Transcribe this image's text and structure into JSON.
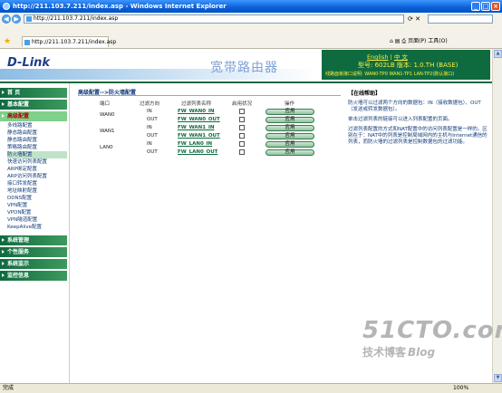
{
  "window": {
    "title": "http://211.103.7.211/index.asp - Windows Internet Explorer"
  },
  "browser": {
    "address": "http://211.103.7.211/index.asp",
    "tab_title": "http://211.103.7.211/index.asp",
    "cmd_page": "页面(P)",
    "cmd_tools": "工具(O)",
    "status": "完成",
    "zoom": "100%"
  },
  "header": {
    "brand": "D-Link",
    "product": "宽带路由器",
    "lang_en": "English",
    "lang_sep": "|",
    "lang_cn": "中 文",
    "model": "型号: 602LB 版本: 1.0.TH (BASE)",
    "line_info": "线路面板接口说明: WAN0-TP0 WAN1-TP1 LAN-TP2(默认接口)"
  },
  "sidebar": {
    "sections": [
      {
        "label": "首 页"
      },
      {
        "label": "基本配置"
      },
      {
        "label": "高级配置"
      }
    ],
    "sub_items": [
      "多线路配置",
      "静态路由配置",
      "静态路由配置",
      "策略路由配置",
      "防火墙配置",
      "快速访问列表配置",
      "ARP绑定配置",
      "ARP访问列表配置",
      "接口转发配置",
      "地址映射配置",
      "DDNS配置",
      "VPN配置",
      "VPDN配置",
      "VPN隧道配置",
      "KeepAlive配置"
    ],
    "sections_bottom": [
      {
        "label": "系统管理"
      },
      {
        "label": "个性服务"
      },
      {
        "label": "系统监示"
      },
      {
        "label": "监控信息"
      }
    ]
  },
  "main": {
    "breadcrumb": "高级配置-->防火墙配置",
    "columns": [
      "端口",
      "过滤方向",
      "过滤列表名称",
      "启用状况",
      "操作"
    ],
    "rows": [
      {
        "port": "WAN0",
        "dir": "IN",
        "list": "FW_WAN0_IN",
        "action": "应用"
      },
      {
        "port": "",
        "dir": "OUT",
        "list": "FW_WAN0_OUT",
        "action": "应用"
      },
      {
        "port": "WAN1",
        "dir": "IN",
        "list": "FW_WAN1_IN",
        "action": "应用"
      },
      {
        "port": "",
        "dir": "OUT",
        "list": "FW_WAN1_OUT",
        "action": "应用"
      },
      {
        "port": "LAN0",
        "dir": "IN",
        "list": "FW_LAN0_IN",
        "action": "应用"
      },
      {
        "port": "",
        "dir": "OUT",
        "list": "FW_LAN0_OUT",
        "action": "应用"
      }
    ]
  },
  "help": {
    "title": "【在线帮助】",
    "p1": "防火墙可以过滤两个方向的数据包：IN（接收数据包）、OUT（发送或转发数据包）。",
    "p2": "单击过滤列表的链接可以进入列表配置的页面。",
    "p3": "过滤列表配置的方式和NAT配置中的访问列表配置是一样的。区别在于：NAT中的列表是控制局域网内的主机与Internet通信的列表，而防火墙的过滤列表是控制数据包的过滤功能。"
  },
  "watermark": {
    "line1": "51CTO.com",
    "line2": "技术博客",
    "line3": "Blog"
  }
}
